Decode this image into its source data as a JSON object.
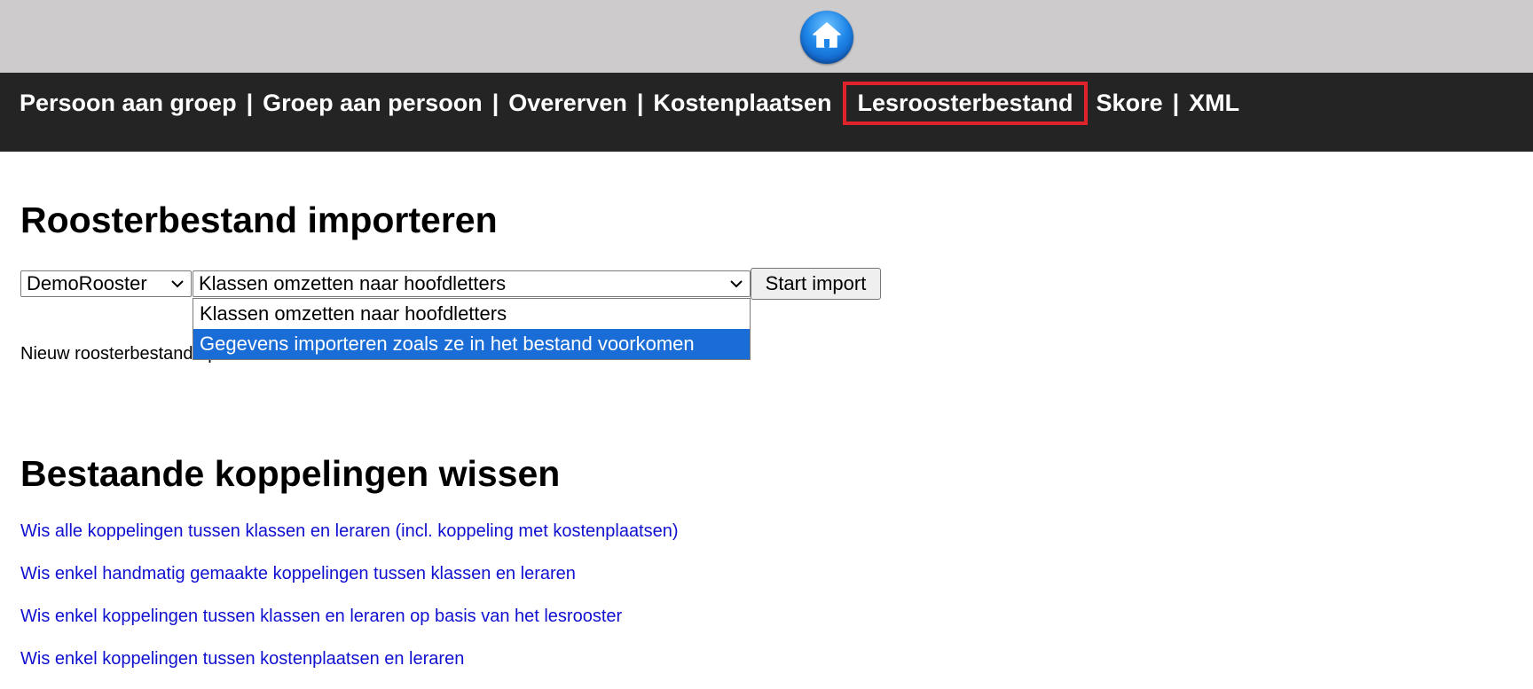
{
  "header": {
    "home_icon": "home-icon",
    "colors": {
      "topbar": "#cdcbcc",
      "navbar": "#242424",
      "highlight": "#e0232a"
    }
  },
  "nav": {
    "items": [
      {
        "label": "Persoon aan groep"
      },
      {
        "label": "Groep aan persoon"
      },
      {
        "label": "Overerven"
      },
      {
        "label": "Kostenplaatsen"
      },
      {
        "label": "Lesroosterbestand"
      },
      {
        "label": "Skore"
      },
      {
        "label": "XML"
      }
    ],
    "separator": "|"
  },
  "import_section": {
    "title": "Roosterbestand importeren",
    "rooster_select": {
      "value": "DemoRooster"
    },
    "mode_select": {
      "value": "Klassen omzetten naar hoofdletters",
      "options": [
        "Klassen omzetten naar hoofdletters",
        "Gegevens importeren zoals ze in het bestand voorkomen"
      ],
      "highlighted_option": 1
    },
    "start_button": "Start import",
    "new_file_text": "Nieuw roosterbestand up"
  },
  "delete_section": {
    "title": "Bestaande koppelingen wissen",
    "links": [
      "Wis alle koppelingen tussen klassen en leraren (incl. koppeling met kostenplaatsen)",
      "Wis enkel handmatig gemaakte koppelingen tussen klassen en leraren",
      "Wis enkel koppelingen tussen klassen en leraren op basis van het lesrooster",
      "Wis enkel koppelingen tussen kostenplaatsen en leraren"
    ]
  }
}
